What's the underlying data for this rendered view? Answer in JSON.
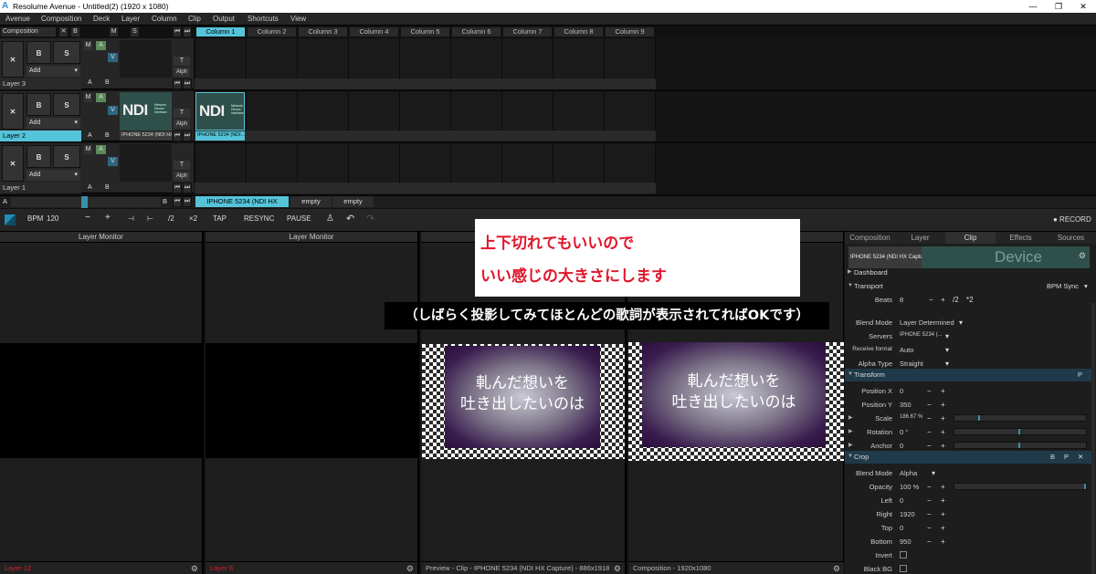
{
  "window": {
    "title": "Resolume Avenue - Untitled(2) (1920 x 1080)",
    "min": "—",
    "max": "❐",
    "close": "✕",
    "logo": "A"
  },
  "menu": [
    "Avenue",
    "Composition",
    "Deck",
    "Layer",
    "Column",
    "Clip",
    "Output",
    "Shortcuts",
    "View"
  ],
  "composition_header": {
    "label": "Composition",
    "x": "✕",
    "b": "B",
    "m": "M",
    "s": "S",
    "prev": "⏮",
    "next": "⏭"
  },
  "columns": [
    "Column 1",
    "Column 2",
    "Column 3",
    "Column 4",
    "Column 5",
    "Column 6",
    "Column 7",
    "Column 8",
    "Column 9"
  ],
  "layers": [
    {
      "name": "Layer 3",
      "active": false,
      "a": "A",
      "b": "B",
      "add": "Add",
      "alph": "Alph",
      "t": "T",
      "x": "✕",
      "bb": "B",
      "s": "S",
      "m": "M",
      "ma": "A",
      "v": "V"
    },
    {
      "name": "Layer 2",
      "active": true,
      "a": "A",
      "b": "B",
      "add": "Add",
      "alph": "Alph",
      "t": "T",
      "x": "✕",
      "bb": "B",
      "s": "S",
      "m": "M",
      "ma": "A",
      "v": "V",
      "ndi_label": "IPHONE 5234 (NDI HX Capture)",
      "ndi_label_col1": "IPHONE 5234 (NDI...",
      "ndi_text": "NDI",
      "ndi_small": "Network Device Interface"
    },
    {
      "name": "Layer 1",
      "active": false,
      "a": "A",
      "b": "B",
      "add": "Add",
      "alph": "Alph",
      "t": "T",
      "x": "✕",
      "bb": "B",
      "s": "S",
      "m": "M",
      "ma": "A",
      "v": "V"
    }
  ],
  "deck": {
    "a": "A",
    "b": "B",
    "clips": [
      "IPHONE 5234 (NDI HX Capture)",
      "empty",
      "empty"
    ]
  },
  "transport": {
    "bpm_label": "BPM",
    "bpm": "120",
    "minus": "−",
    "plus": "+",
    "left": "⊣",
    "right": "⊢",
    "half": "/2",
    "double": "×2",
    "tap": "TAP",
    "resync": "RESYNC",
    "pause": "PAUSE",
    "record": "● RECORD"
  },
  "monitors": [
    {
      "header": "Layer Monitor",
      "footer": "Layer 12"
    },
    {
      "header": "Layer Monitor",
      "footer": "Layer 8"
    },
    {
      "header": "",
      "footer": "Preview - Clip - IPHONE 5234 (NDI HX Capture) - 886x1918"
    },
    {
      "header": "",
      "footer": "Composition - 1920x1080"
    }
  ],
  "lyrics": {
    "line1": "軋んだ想いを",
    "line2": "吐き出したいのは"
  },
  "annotation": {
    "line1": "上下切れてもいいので",
    "line2": "いい感じの大きさにします",
    "note": "（しばらく投影してみてほとんどの歌詞が表示されてればOKです）"
  },
  "right_panel": {
    "tabs": [
      "Composition",
      "Layer",
      "Clip",
      "Effects",
      "Sources"
    ],
    "active_tab": "Clip",
    "clip_name": "IPHONE 5234 (NDI HX Captu...",
    "clip_thumb_text": "Device",
    "sections": {
      "dashboard": "Dashboard",
      "transport": "Transport",
      "bpm_sync": "BPM Sync",
      "transform": "Transform",
      "crop": "Crop"
    },
    "params": {
      "beats": {
        "label": "Beats",
        "value": "8",
        "half": "/2",
        "double": "*2"
      },
      "blend_mode": {
        "label": "Blend Mode",
        "value": "Layer Determined"
      },
      "servers": {
        "label": "Servers",
        "value": "IPHONE 5234 (..."
      },
      "receive_format": {
        "label": "Receive format",
        "value": "Auto"
      },
      "alpha_type": {
        "label": "Alpha Type",
        "value": "Straight"
      },
      "position_x": {
        "label": "Position X",
        "value": "0"
      },
      "position_y": {
        "label": "Position Y",
        "value": "350"
      },
      "scale": {
        "label": "Scale",
        "value": "186.67 %"
      },
      "rotation": {
        "label": "Rotation",
        "value": "0 °"
      },
      "anchor": {
        "label": "Anchor",
        "value": "0"
      },
      "crop_blend_mode": {
        "label": "Blend Mode",
        "value": "Alpha"
      },
      "opacity": {
        "label": "Opacity",
        "value": "100 %"
      },
      "left": {
        "label": "Left",
        "value": "0"
      },
      "right": {
        "label": "Right",
        "value": "1920"
      },
      "top": {
        "label": "Top",
        "value": "0"
      },
      "bottom": {
        "label": "Bottom",
        "value": "950"
      },
      "invert": {
        "label": "Invert"
      },
      "black_bg": {
        "label": "Black BG"
      }
    }
  },
  "colors": {
    "accent": "#55c4d9",
    "annotation_red": "#e0162b",
    "ndi_bg": "#2f4f4a"
  }
}
